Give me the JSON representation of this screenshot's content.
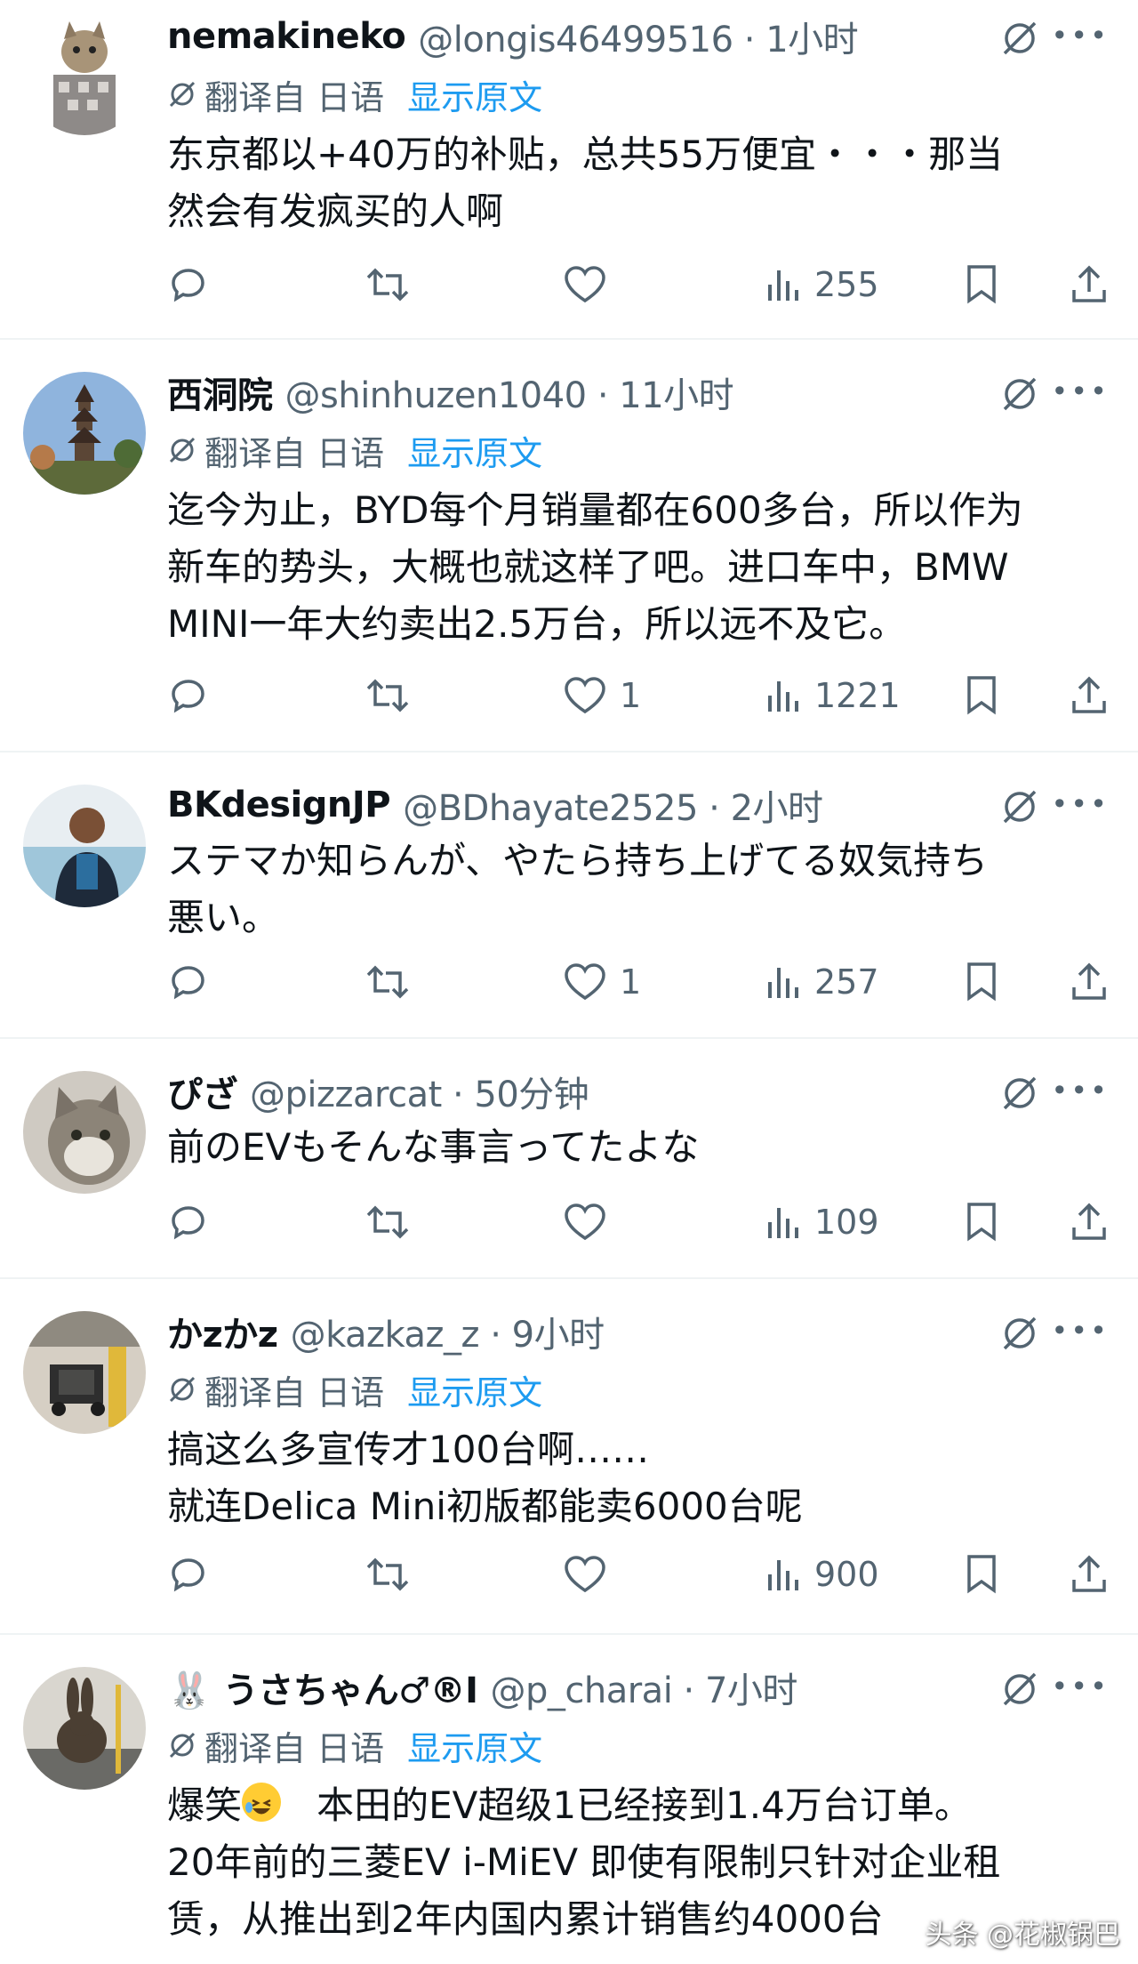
{
  "tweets": [
    {
      "name": "nemakineko",
      "handle": "@longis46499516 · 1小时",
      "translation": {
        "label": "翻译自 日语",
        "link": "显示原文"
      },
      "text": "东京都以+40万的补贴，总共55万便宜・・・那当\n然会有发疯买的人啊",
      "stats": {
        "replies": "",
        "reposts": "",
        "likes": "",
        "views": "255"
      },
      "avatar_color": "#9a8f86"
    },
    {
      "name": "西洞院",
      "handle": "@shinhuzen1040 · 11小时",
      "translation": {
        "label": "翻译自 日语",
        "link": "显示原文"
      },
      "text": "迄今为止，BYD每个月销量都在600多台，所以作为\n新车的势头，大概也就这样了吧。进口车中，BMW\nMINI一年大约卖出2.5万台，所以远不及它。",
      "stats": {
        "replies": "",
        "reposts": "",
        "likes": "1",
        "views": "1221"
      },
      "avatar_color": "#6f8fb5"
    },
    {
      "name": "BKdesignJP",
      "handle": "@BDhayate2525 · 2小时",
      "translation": null,
      "text": "ステマか知らんが、やたら持ち上げてる奴気持ち\n悪い。",
      "stats": {
        "replies": "",
        "reposts": "",
        "likes": "1",
        "views": "257"
      },
      "avatar_color": "#7fb3d0"
    },
    {
      "name": "ぴざ",
      "handle": "@pizzarcat · 50分钟",
      "translation": null,
      "text": "前のEVもそんな事言ってたよな",
      "stats": {
        "replies": "",
        "reposts": "",
        "likes": "",
        "views": "109"
      },
      "avatar_color": "#8a8a86"
    },
    {
      "name": "かzかz",
      "handle": "@kazkaz_z · 9小时",
      "translation": {
        "label": "翻译自 日语",
        "link": "显示原文"
      },
      "text": "搞这么多宣传才100台啊……\n就连Delica Mini初版都能卖6000台呢",
      "stats": {
        "replies": "",
        "reposts": "",
        "likes": "",
        "views": "900"
      },
      "avatar_color": "#a09a90"
    },
    {
      "name": "🐰 うさちゃん♂®I",
      "handle": "@p_charai · 7小时",
      "translation": {
        "label": "翻译自 日语",
        "link": "显示原文"
      },
      "text_parts": [
        "爆笑",
        "   本田的EV超级1已经接到1.4万台订单。\n20年前的三菱EV i-MiEV 即使有限制只针对企业租\n赁，从推出到2年内国内累计销售约4000台"
      ],
      "stats": {
        "replies": "",
        "reposts": "",
        "likes": "",
        "views": ""
      },
      "avatar_color": "#b5b5b0"
    }
  ],
  "watermark": "头条 @花椒锅巴",
  "colors": {
    "accent": "#1d9bf0",
    "secondary_text": "#536471",
    "divider": "#eff3f4"
  },
  "icons": [
    "reply-icon",
    "repost-icon",
    "like-icon",
    "views-icon",
    "bookmark-icon",
    "share-icon",
    "grok-icon",
    "more-icon",
    "translate-icon"
  ]
}
